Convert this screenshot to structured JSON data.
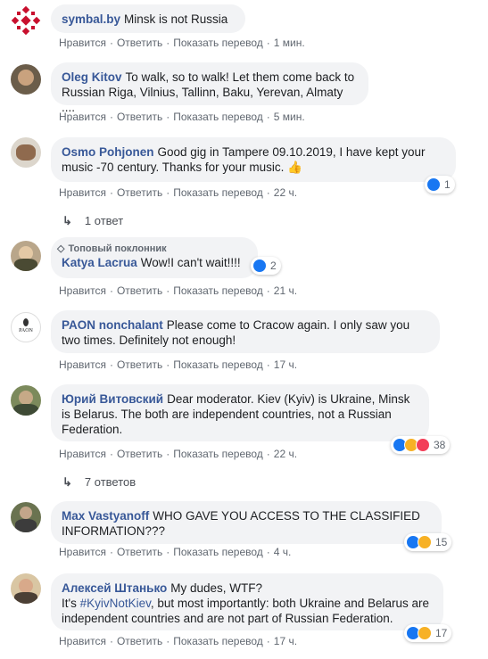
{
  "actions": {
    "like": "Нравится",
    "reply": "Ответить",
    "translate": "Показать перевод"
  },
  "colors": {
    "link": "#385898",
    "bubble": "#f2f3f5",
    "like": "#1877f2",
    "haha": "#f7b125",
    "love": "#f33e58"
  },
  "comments": [
    {
      "author": "symbal.by",
      "text": "Minsk is not Russia",
      "time": "1 мин."
    },
    {
      "author": "Oleg Kitov",
      "text": "To walk, so to walk! Let them come back to Russian Riga, Vilnius, Tallinn, Baku, Yerevan, Almaty ....",
      "time": "5 мин."
    },
    {
      "author": "Osmo Pohjonen",
      "text": "Good gig in Tampere 09.10.2019, I have kept your music -70 century. Thanks for your music. 👍",
      "time": "22 ч.",
      "reactions": "1",
      "replies": "1 ответ"
    },
    {
      "author": "Katya Lacrua",
      "badge": "Топовый поклонник",
      "text": "Wow!I can't wait!!!!",
      "time": "21 ч.",
      "reactions": "2"
    },
    {
      "author": "PAON nonchalant",
      "text": "Please come to Cracow again. I only saw you two times. Definitely not enough!",
      "time": "17 ч."
    },
    {
      "author": "Юрий Витовский",
      "text": "Dear moderator. Kiev (Kyiv) is Ukraine, Minsk is Belarus. The both are independent countries, not a Russian Federation.",
      "time": "22 ч.",
      "reactions": "38",
      "replies": "7 ответов"
    },
    {
      "author": "Max Vastyanoff",
      "text": "WHO GAVE YOU ACCESS TO THE CLASSIFIED INFORMATION???",
      "time": "4 ч.",
      "reactions": "15"
    },
    {
      "author": "Алексей Штанько",
      "text": "My dudes, WTF?",
      "text2a": "It's ",
      "hashtag": "#KyivNotKiev",
      "text2b": ", but most importantly: both Ukraine and Belarus are independent countries and are not part of Russian Federation.",
      "time": "17 ч.",
      "reactions": "17"
    }
  ]
}
